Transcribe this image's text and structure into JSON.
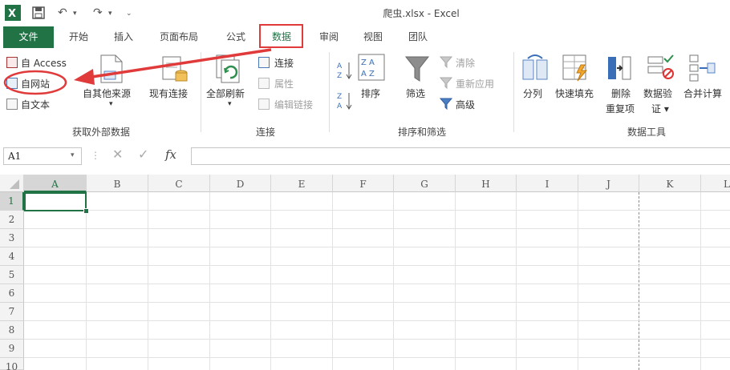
{
  "window": {
    "title": "爬虫.xlsx - Excel"
  },
  "tabs": [
    {
      "label": "文件"
    },
    {
      "label": "开始"
    },
    {
      "label": "插入"
    },
    {
      "label": "页面布局"
    },
    {
      "label": "公式"
    },
    {
      "label": "数据"
    },
    {
      "label": "审阅"
    },
    {
      "label": "视图"
    },
    {
      "label": "团队"
    }
  ],
  "ribbon": {
    "external": {
      "access": "自 Access",
      "web": "自网站",
      "text": "自文本",
      "other": "自其他来源",
      "existing": "现有连接",
      "group": "获取外部数据"
    },
    "connections": {
      "refresh_all": "全部刷新",
      "connections": "连接",
      "properties": "属性",
      "edit_links": "编辑链接",
      "group": "连接"
    },
    "sort_filter": {
      "sort": "排序",
      "filter": "筛选",
      "clear": "清除",
      "reapply": "重新应用",
      "advanced": "高级",
      "group": "排序和筛选"
    },
    "data_tools": {
      "text_to_columns": "分列",
      "flash_fill": "快速填充",
      "remove_dup_1": "删除",
      "remove_dup_2": "重复项",
      "validation_1": "数据验",
      "validation_2": "证 ▾",
      "consolidate": "合并计算",
      "group": "数据工具"
    }
  },
  "formula_bar": {
    "name_box": "A1",
    "fx": "fx",
    "value": ""
  },
  "grid": {
    "columns": [
      "A",
      "B",
      "C",
      "D",
      "E",
      "F",
      "G",
      "H",
      "I",
      "J",
      "K",
      "L"
    ],
    "rows": [
      "1",
      "2",
      "3",
      "4",
      "5",
      "6",
      "7",
      "8",
      "9",
      "10"
    ],
    "active_cell": "A1"
  },
  "colors": {
    "excel_green": "#217346",
    "annotation_red": "#e03a3a"
  }
}
